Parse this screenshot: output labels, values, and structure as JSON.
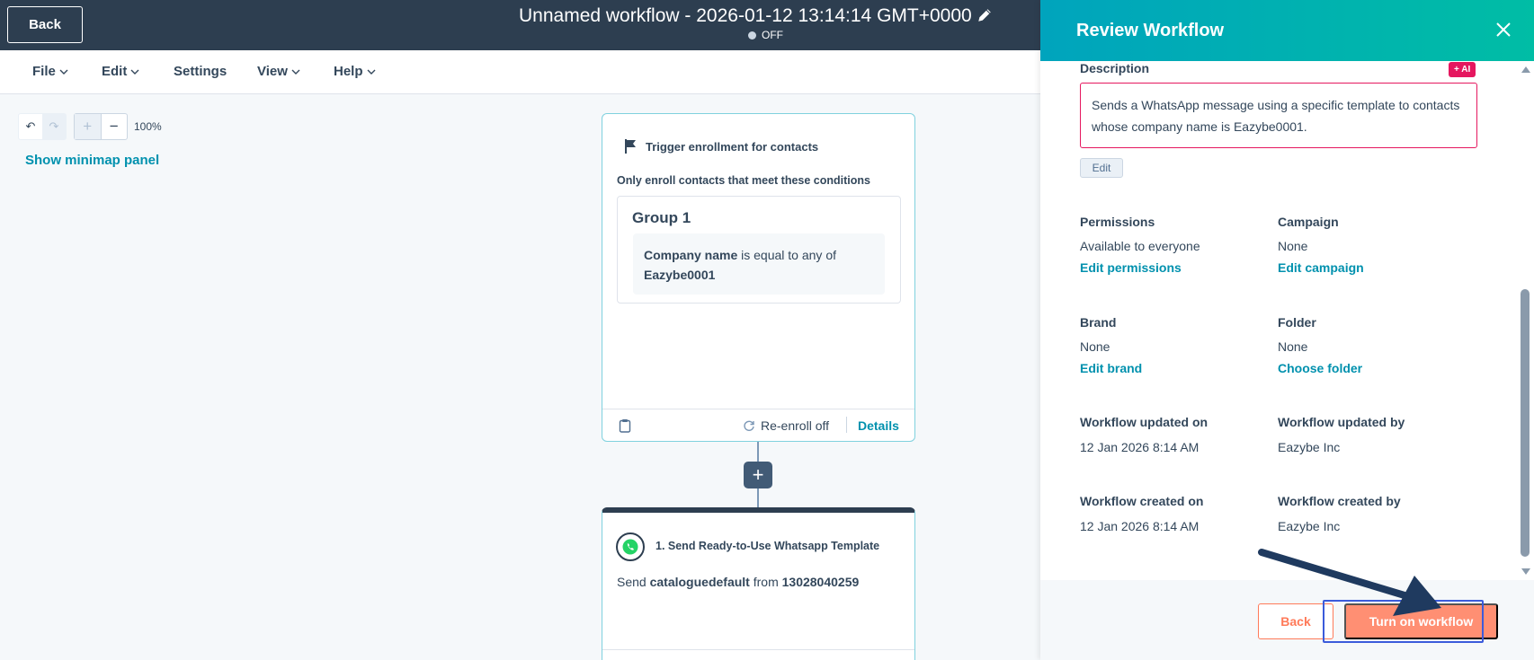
{
  "header": {
    "back_label": "Back",
    "title": "Unnamed workflow - 2026-01-12 13:14:14 GMT+0000",
    "status": "OFF"
  },
  "menu": {
    "items": [
      {
        "label": "File",
        "has_dropdown": true
      },
      {
        "label": "Edit",
        "has_dropdown": true
      },
      {
        "label": "Settings",
        "has_dropdown": false
      },
      {
        "label": "View",
        "has_dropdown": true
      },
      {
        "label": "Help",
        "has_dropdown": true
      }
    ]
  },
  "canvas": {
    "zoom": "100%",
    "minimap_link": "Show minimap panel"
  },
  "trigger": {
    "title": "Trigger enrollment for contacts",
    "conditions_title": "Only enroll contacts that meet these conditions",
    "group_title": "Group 1",
    "condition_property": "Company name",
    "condition_operator": "is equal to any of",
    "condition_value": "Eazybe0001",
    "reenroll": "Re-enroll off",
    "details": "Details"
  },
  "action": {
    "title": "1. Send Ready-to-Use Whatsapp Template",
    "send_prefix": "Send",
    "template": "cataloguedefault",
    "from_word": "from",
    "phone": "13028040259"
  },
  "panel": {
    "title": "Review Workflow",
    "description_label": "Description",
    "ai_badge": "+ AI",
    "description": "Sends a WhatsApp message using a specific template to contacts whose company name is Eazybe0001.",
    "edit_label": "Edit",
    "permissions": {
      "label": "Permissions",
      "value": "Available to everyone",
      "link": "Edit permissions"
    },
    "campaign": {
      "label": "Campaign",
      "value": "None",
      "link": "Edit campaign"
    },
    "brand": {
      "label": "Brand",
      "value": "None",
      "link": "Edit brand"
    },
    "folder": {
      "label": "Folder",
      "value": "None",
      "link": "Choose folder"
    },
    "updated_on": {
      "label": "Workflow updated on",
      "value": "12 Jan 2026 8:14 AM"
    },
    "updated_by": {
      "label": "Workflow updated by",
      "value": "Eazybe Inc"
    },
    "created_on": {
      "label": "Workflow created on",
      "value": "12 Jan 2026 8:14 AM"
    },
    "created_by": {
      "label": "Workflow created by",
      "value": "Eazybe Inc"
    },
    "back_label": "Back",
    "turn_on_label": "Turn on workflow"
  },
  "colors": {
    "header_bg": "#2d3e50",
    "link": "#0091ae",
    "primary_button": "#ff8f73",
    "ai_accent": "#e5175f",
    "annotation_arrow": "#1f3a5f",
    "annotation_box": "#3b5bdb"
  }
}
